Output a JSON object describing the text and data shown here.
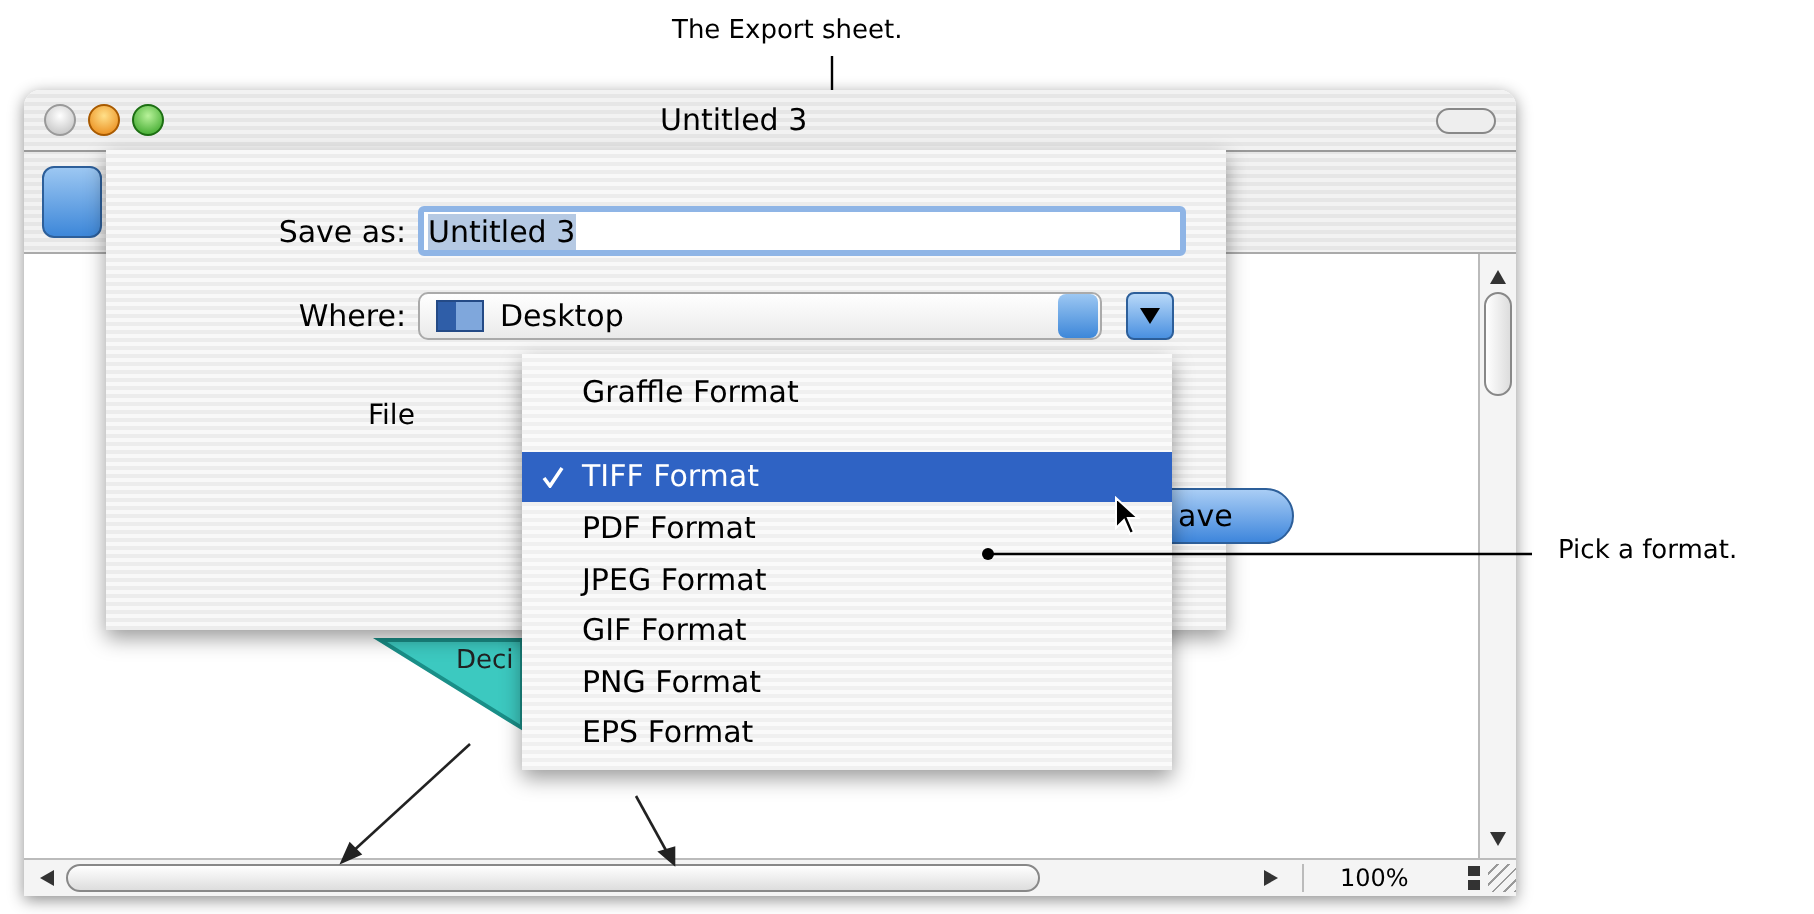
{
  "callouts": [
    {
      "kind": "top",
      "text": "The Export sheet."
    },
    {
      "kind": "right",
      "text": "Pick a format."
    }
  ],
  "window": {
    "title": "Untitled 3"
  },
  "diagram": {
    "label": "Deci"
  },
  "sheet": {
    "save_as_label": "Save as:",
    "save_as_value": "Untitled 3",
    "where_label": "Where:",
    "where_value": "Desktop",
    "file_label": "File",
    "buttons": [
      {
        "label": "ave",
        "default": true
      }
    ]
  },
  "format_menu": {
    "items": [
      {
        "kind": "item",
        "label": "Graffle Format",
        "selected": false,
        "checked": false
      },
      {
        "kind": "separator"
      },
      {
        "kind": "item",
        "label": "TIFF Format",
        "selected": true,
        "checked": true
      },
      {
        "kind": "item",
        "label": "PDF Format",
        "selected": false,
        "checked": false
      },
      {
        "kind": "item",
        "label": "JPEG Format",
        "selected": false,
        "checked": false
      },
      {
        "kind": "item",
        "label": "GIF Format",
        "selected": false,
        "checked": false
      },
      {
        "kind": "item",
        "label": "PNG Format",
        "selected": false,
        "checked": false
      },
      {
        "kind": "item",
        "label": "EPS Format",
        "selected": false,
        "checked": false
      }
    ]
  },
  "status_bar": {
    "zoom": "100%"
  }
}
